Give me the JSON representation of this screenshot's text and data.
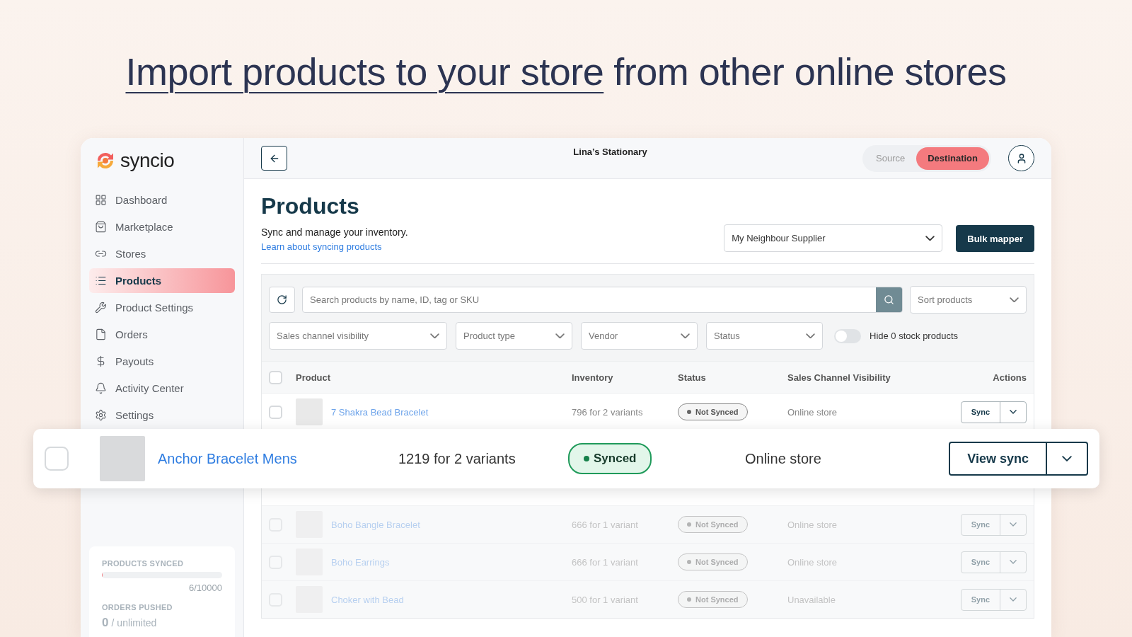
{
  "headline": {
    "underlined": "Import products to your store",
    "rest": "from other online stores"
  },
  "sidebar": {
    "logo": "syncio",
    "items": [
      {
        "label": "Dashboard",
        "selected": false
      },
      {
        "label": "Marketplace",
        "selected": false
      },
      {
        "label": "Stores",
        "selected": false
      },
      {
        "label": "Products",
        "selected": true
      },
      {
        "label": "Product Settings",
        "selected": false
      },
      {
        "label": "Orders",
        "selected": false
      },
      {
        "label": "Payouts",
        "selected": false
      },
      {
        "label": "Activity Center",
        "selected": false
      },
      {
        "label": "Settings",
        "selected": false
      }
    ],
    "stats": {
      "products_label": "PRODUCTS SYNCED",
      "products_bar": {
        "level": 0.0006
      },
      "products_count": "6/10000",
      "orders_label": "ORDERS PUSHED",
      "orders_count": "0",
      "orders_sep": "/",
      "orders_limit": "unlimited"
    }
  },
  "topbar": {
    "store_name": "Lina’s Stationary",
    "modes": [
      {
        "label": "Source",
        "selected": false
      },
      {
        "label": "Destination",
        "selected": true
      }
    ]
  },
  "page": {
    "title": "Products",
    "subtitle": "Sync and manage your inventory.",
    "link": "Learn about syncing products",
    "supplier": "My Neighbour Supplier",
    "bulk_button": "Bulk mapper"
  },
  "filters": {
    "search_placeholder": "Search products by name, ID, tag or SKU",
    "sort": "Sort products",
    "dropdowns": [
      "Sales channel visibility",
      "Product type",
      "Vendor",
      "Status"
    ],
    "toggle": {
      "label": "Hide 0 stock products",
      "on": false
    }
  },
  "table": {
    "all_checked": false,
    "columns": [
      "Product",
      "Inventory",
      "Status",
      "Sales Channel Visibility",
      "Actions"
    ],
    "rows": [
      {
        "name": "7 Shakra Bead Bracelet",
        "inventory": "796 for 2 variants",
        "status": "Not Synced",
        "synced": false,
        "visibility": "Online store",
        "action": "Sync",
        "checked": false,
        "faded": false
      },
      {
        "name": "Boho Bangle Bracelet",
        "inventory": "666 for 1 variant",
        "status": "Not Synced",
        "synced": false,
        "visibility": "Online store",
        "action": "Sync",
        "checked": false,
        "faded": true
      },
      {
        "name": "Boho Earrings",
        "inventory": "666 for 1 variant",
        "status": "Not Synced",
        "synced": false,
        "visibility": "Online store",
        "action": "Sync",
        "checked": false,
        "faded": true
      },
      {
        "name": "Choker with Bead",
        "inventory": "500 for 1 variant",
        "status": "Not Synced",
        "synced": false,
        "visibility": "Unavailable",
        "action": "Sync",
        "checked": false,
        "faded": true
      }
    ]
  },
  "highlight": {
    "name": "Anchor Bracelet Mens",
    "inventory": "1219 for 2 variants",
    "status": "Synced",
    "synced": true,
    "visibility": "Online store",
    "action": "View sync",
    "checked": false
  }
}
